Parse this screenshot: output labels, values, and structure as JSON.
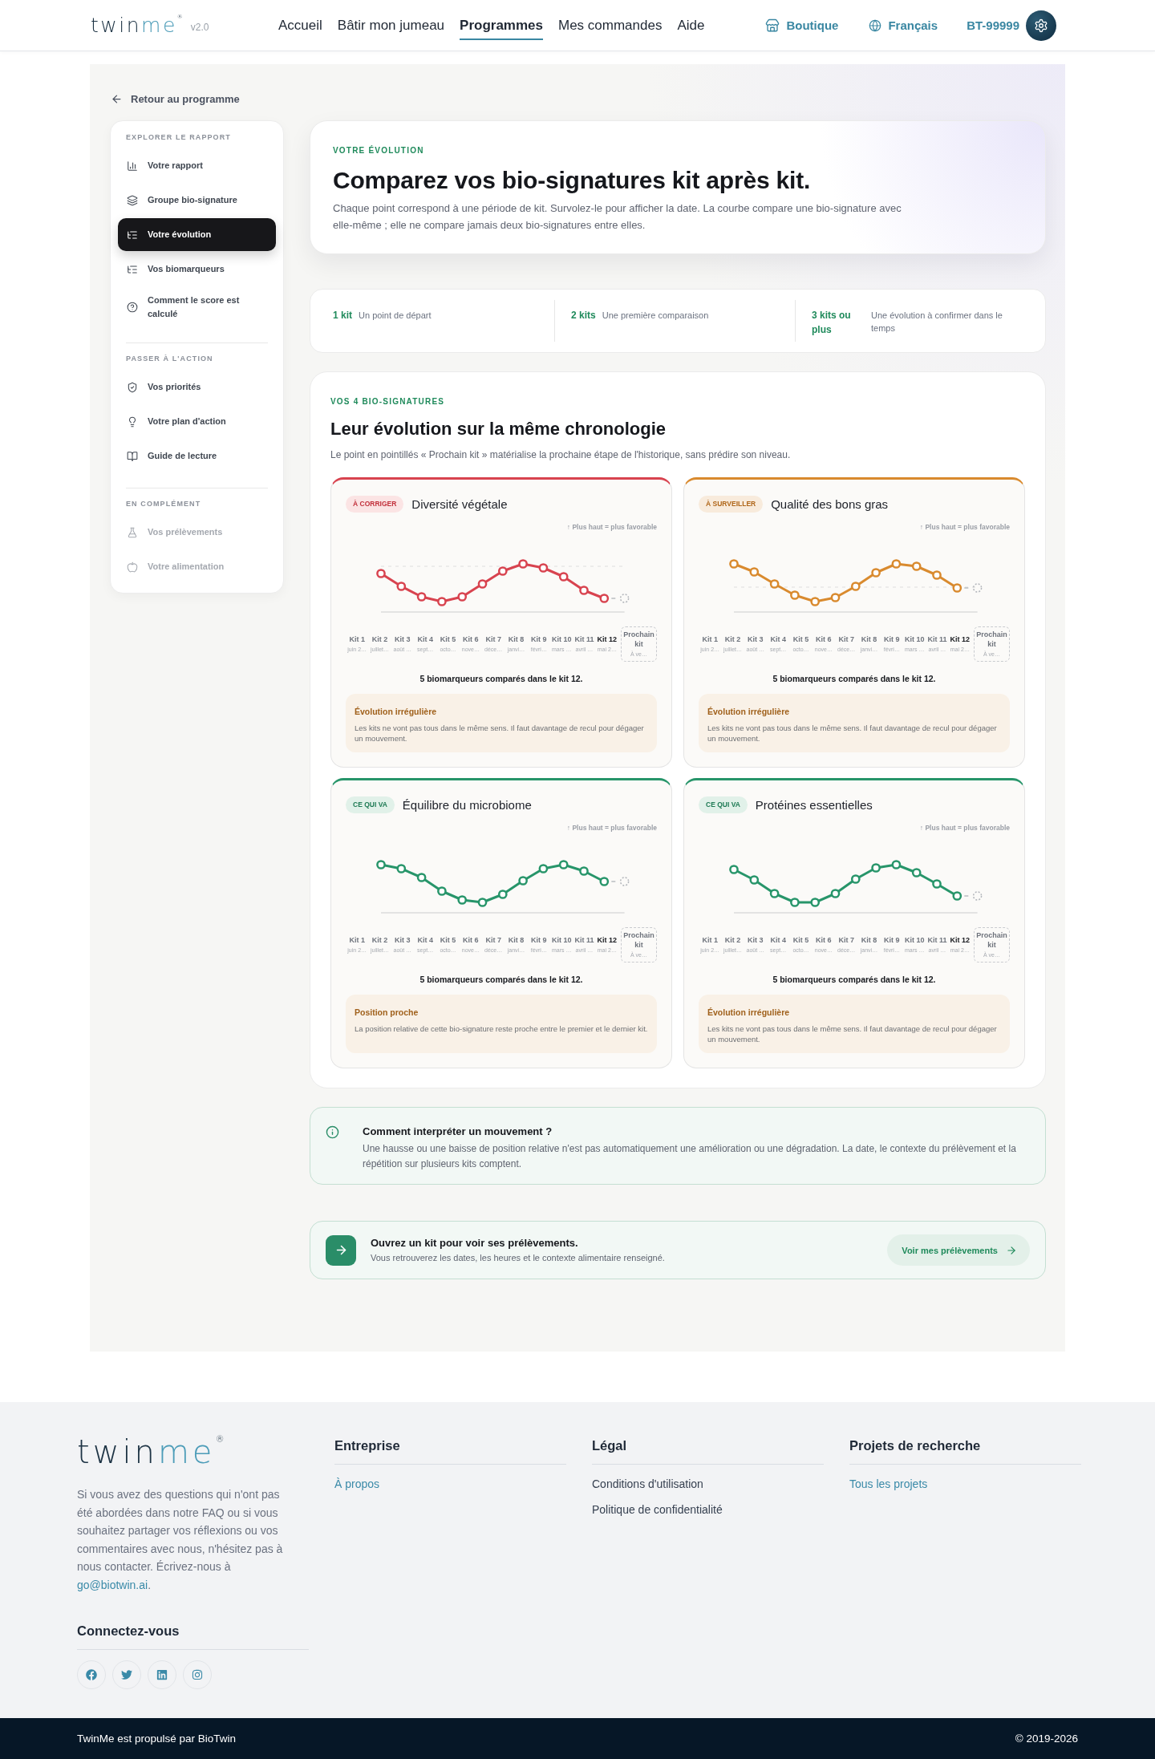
{
  "header": {
    "logo": {
      "parts": [
        "twin",
        "me"
      ],
      "registered": "®"
    },
    "version": "v2.0",
    "nav": [
      {
        "label": "Accueil",
        "selected": false
      },
      {
        "label": "Bâtir mon jumeau",
        "selected": false
      },
      {
        "label": "Programmes",
        "selected": true
      },
      {
        "label": "Mes commandes",
        "selected": false
      },
      {
        "label": "Aide",
        "selected": false
      }
    ],
    "shop": "Boutique",
    "language": "Français",
    "account": "BT-99999"
  },
  "back_link": "Retour au programme",
  "sidebar": {
    "sections": [
      {
        "title": "EXPLORER LE RAPPORT",
        "items": [
          {
            "label": "Votre rapport",
            "selected": false,
            "disabled": false
          },
          {
            "label": "Groupe bio-signature",
            "selected": false,
            "disabled": false
          },
          {
            "label": "Votre évolution",
            "selected": true,
            "disabled": false
          },
          {
            "label": "Vos biomarqueurs",
            "selected": false,
            "disabled": false
          },
          {
            "label": "Comment le score est calculé",
            "selected": false,
            "disabled": false
          }
        ]
      },
      {
        "title": "PASSER À L'ACTION",
        "items": [
          {
            "label": "Vos priorités",
            "selected": false,
            "disabled": false
          },
          {
            "label": "Votre plan d'action",
            "selected": false,
            "disabled": false
          },
          {
            "label": "Guide de lecture",
            "selected": false,
            "disabled": false
          }
        ]
      },
      {
        "title": "EN COMPLÉMENT",
        "items": [
          {
            "label": "Vos prélèvements",
            "selected": false,
            "disabled": true
          },
          {
            "label": "Votre alimentation",
            "selected": false,
            "disabled": true
          }
        ]
      }
    ]
  },
  "hero": {
    "eyebrow": "VOTRE ÉVOLUTION",
    "title": "Comparez vos bio-signatures kit après kit.",
    "description": "Chaque point correspond à une période de kit. Survolez-le pour afficher la date. La courbe compare une bio-signature avec elle-même ; elle ne compare jamais deux bio-signatures entre elles."
  },
  "steps": [
    {
      "count": "1 kit",
      "text": "Un point de départ"
    },
    {
      "count": "2 kits",
      "text": "Une première comparaison"
    },
    {
      "count": "3 kits ou plus",
      "text": "Une évolution à confirmer dans le temps"
    }
  ],
  "signatures": {
    "eyebrow": "VOS 4 BIO-SIGNATURES",
    "title": "Leur évolution sur la même chronologie",
    "subtitle": "Le point en pointillés « Prochain kit » matérialise la prochaine étape de l'historique, sans prédire son niveau.",
    "cards": [
      {
        "kind": "fix",
        "badge": "À CORRIGER",
        "title": "Diversité végétale",
        "hint": "↑ Plus haut = plus favorable",
        "kits": [
          {
            "label": "Kit 1",
            "date": "juin 2…",
            "current": false
          },
          {
            "label": "Kit 2",
            "date": "juillet…",
            "current": false
          },
          {
            "label": "Kit 3",
            "date": "août …",
            "current": false
          },
          {
            "label": "Kit 4",
            "date": "sept…",
            "current": false
          },
          {
            "label": "Kit 5",
            "date": "octo…",
            "current": false
          },
          {
            "label": "Kit 6",
            "date": "nove…",
            "current": false
          },
          {
            "label": "Kit 7",
            "date": "déce…",
            "current": false
          },
          {
            "label": "Kit 8",
            "date": "janvi…",
            "current": false
          },
          {
            "label": "Kit 9",
            "date": "févri…",
            "current": false
          },
          {
            "label": "Kit 10",
            "date": "mars …",
            "current": false
          },
          {
            "label": "Kit 11",
            "date": "avril …",
            "current": false
          },
          {
            "label": "Kit 12",
            "date": "mai 2…",
            "current": true
          }
        ],
        "next_kit": {
          "label": "Prochain kit",
          "date": "À ve…"
        },
        "summary": "5 biomarqueurs comparés dans le kit 12.",
        "note": {
          "title": "Évolution irrégulière",
          "text": "Les kits ne vont pas tous dans le même sens. Il faut davantage de recul pour dégager un mouvement."
        }
      },
      {
        "kind": "watch",
        "badge": "À SURVEILLER",
        "title": "Qualité des bons gras",
        "hint": "↑ Plus haut = plus favorable",
        "kits": [
          {
            "label": "Kit 1",
            "date": "juin 2…",
            "current": false
          },
          {
            "label": "Kit 2",
            "date": "juillet…",
            "current": false
          },
          {
            "label": "Kit 3",
            "date": "août …",
            "current": false
          },
          {
            "label": "Kit 4",
            "date": "sept…",
            "current": false
          },
          {
            "label": "Kit 5",
            "date": "octo…",
            "current": false
          },
          {
            "label": "Kit 6",
            "date": "nove…",
            "current": false
          },
          {
            "label": "Kit 7",
            "date": "déce…",
            "current": false
          },
          {
            "label": "Kit 8",
            "date": "janvi…",
            "current": false
          },
          {
            "label": "Kit 9",
            "date": "févri…",
            "current": false
          },
          {
            "label": "Kit 10",
            "date": "mars …",
            "current": false
          },
          {
            "label": "Kit 11",
            "date": "avril …",
            "current": false
          },
          {
            "label": "Kit 12",
            "date": "mai 2…",
            "current": true
          }
        ],
        "next_kit": {
          "label": "Prochain kit",
          "date": "À ve…"
        },
        "summary": "5 biomarqueurs comparés dans le kit 12.",
        "note": {
          "title": "Évolution irrégulière",
          "text": "Les kits ne vont pas tous dans le même sens. Il faut davantage de recul pour dégager un mouvement."
        }
      },
      {
        "kind": "good",
        "badge": "CE QUI VA",
        "title": "Équilibre du microbiome",
        "hint": "↑ Plus haut = plus favorable",
        "kits": [
          {
            "label": "Kit 1",
            "date": "juin 2…",
            "current": false
          },
          {
            "label": "Kit 2",
            "date": "juillet…",
            "current": false
          },
          {
            "label": "Kit 3",
            "date": "août …",
            "current": false
          },
          {
            "label": "Kit 4",
            "date": "sept…",
            "current": false
          },
          {
            "label": "Kit 5",
            "date": "octo…",
            "current": false
          },
          {
            "label": "Kit 6",
            "date": "nove…",
            "current": false
          },
          {
            "label": "Kit 7",
            "date": "déce…",
            "current": false
          },
          {
            "label": "Kit 8",
            "date": "janvi…",
            "current": false
          },
          {
            "label": "Kit 9",
            "date": "févri…",
            "current": false
          },
          {
            "label": "Kit 10",
            "date": "mars …",
            "current": false
          },
          {
            "label": "Kit 11",
            "date": "avril …",
            "current": false
          },
          {
            "label": "Kit 12",
            "date": "mai 2…",
            "current": true
          }
        ],
        "next_kit": {
          "label": "Prochain kit",
          "date": "À ve…"
        },
        "summary": "5 biomarqueurs comparés dans le kit 12.",
        "note": {
          "title": "Position proche",
          "text": "La position relative de cette bio-signature reste proche entre le premier et le dernier kit."
        }
      },
      {
        "kind": "good",
        "badge": "CE QUI VA",
        "title": "Protéines essentielles",
        "hint": "↑ Plus haut = plus favorable",
        "kits": [
          {
            "label": "Kit 1",
            "date": "juin 2…",
            "current": false
          },
          {
            "label": "Kit 2",
            "date": "juillet…",
            "current": false
          },
          {
            "label": "Kit 3",
            "date": "août …",
            "current": false
          },
          {
            "label": "Kit 4",
            "date": "sept…",
            "current": false
          },
          {
            "label": "Kit 5",
            "date": "octo…",
            "current": false
          },
          {
            "label": "Kit 6",
            "date": "nove…",
            "current": false
          },
          {
            "label": "Kit 7",
            "date": "déce…",
            "current": false
          },
          {
            "label": "Kit 8",
            "date": "janvi…",
            "current": false
          },
          {
            "label": "Kit 9",
            "date": "févri…",
            "current": false
          },
          {
            "label": "Kit 10",
            "date": "mars …",
            "current": false
          },
          {
            "label": "Kit 11",
            "date": "avril …",
            "current": false
          },
          {
            "label": "Kit 12",
            "date": "mai 2…",
            "current": true
          }
        ],
        "next_kit": {
          "label": "Prochain kit",
          "date": "À ve…"
        },
        "summary": "5 biomarqueurs comparés dans le kit 12.",
        "note": {
          "title": "Évolution irrégulière",
          "text": "Les kits ne vont pas tous dans le même sens. Il faut davantage de recul pour dégager un mouvement."
        }
      }
    ]
  },
  "info": {
    "title": "Comment interpréter un mouvement ?",
    "text": "Une hausse ou une baisse de position relative n'est pas automatiquement une amélioration ou une dégradation. La date, le contexte du prélèvement et la répétition sur plusieurs kits comptent."
  },
  "cta": {
    "title": "Ouvrez un kit pour voir ses prélèvements.",
    "text": "Vous retrouverez les dates, les heures et le contexte alimentaire renseigné.",
    "button": "Voir mes prélèvements"
  },
  "footer": {
    "logo": {
      "parts": [
        "twin",
        "me"
      ],
      "registered": "®"
    },
    "contact": {
      "text": "Si vous avez des questions qui n'ont pas été abordées dans notre FAQ ou si vous souhaitez partager vos réflexions ou vos commentaires avec nous, n'hésitez pas à nous contacter. Écrivez-nous à",
      "email": "go@biotwin.ai",
      "after": "."
    },
    "social_title": "Connectez-vous",
    "columns": [
      {
        "title": "Entreprise",
        "links": [
          {
            "label": "À propos",
            "kind": "accent"
          }
        ]
      },
      {
        "title": "Légal",
        "links": [
          {
            "label": "Conditions d'utilisation",
            "kind": "plain"
          },
          {
            "label": "Politique de confidentialité",
            "kind": "plain"
          }
        ]
      },
      {
        "title": "Projets de recherche",
        "links": [
          {
            "label": "Tous les projets",
            "kind": "accent"
          }
        ]
      }
    ]
  },
  "bottom_bar": {
    "credit": "TwinMe est propulsé par BioTwin",
    "copyright": "© 2019-2026"
  }
}
